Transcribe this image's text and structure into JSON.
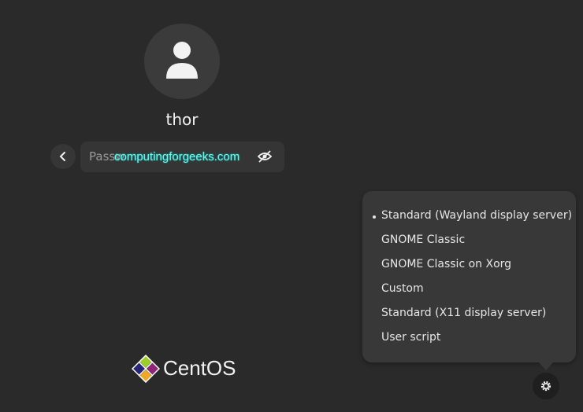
{
  "user": {
    "name": "thor"
  },
  "password": {
    "placeholder": "Passw",
    "value": ""
  },
  "watermark": "computingforgeeks.com",
  "session_menu": {
    "items": [
      {
        "label": "Standard (Wayland display server)",
        "selected": true
      },
      {
        "label": "GNOME Classic",
        "selected": false
      },
      {
        "label": "GNOME Classic on Xorg",
        "selected": false
      },
      {
        "label": "Custom",
        "selected": false
      },
      {
        "label": "Standard (X11 display server)",
        "selected": false
      },
      {
        "label": "User script",
        "selected": false
      }
    ]
  },
  "brand": {
    "name": "CentOS"
  },
  "icons": {
    "avatar": "user-avatar-icon",
    "back": "chevron-left-icon",
    "reveal": "eye-slash-icon",
    "settings": "gear-icon",
    "logo": "centos-logo-icon"
  },
  "colors": {
    "background": "#2a2a2a",
    "menu": "#383838",
    "watermark": "#7af0e4"
  }
}
